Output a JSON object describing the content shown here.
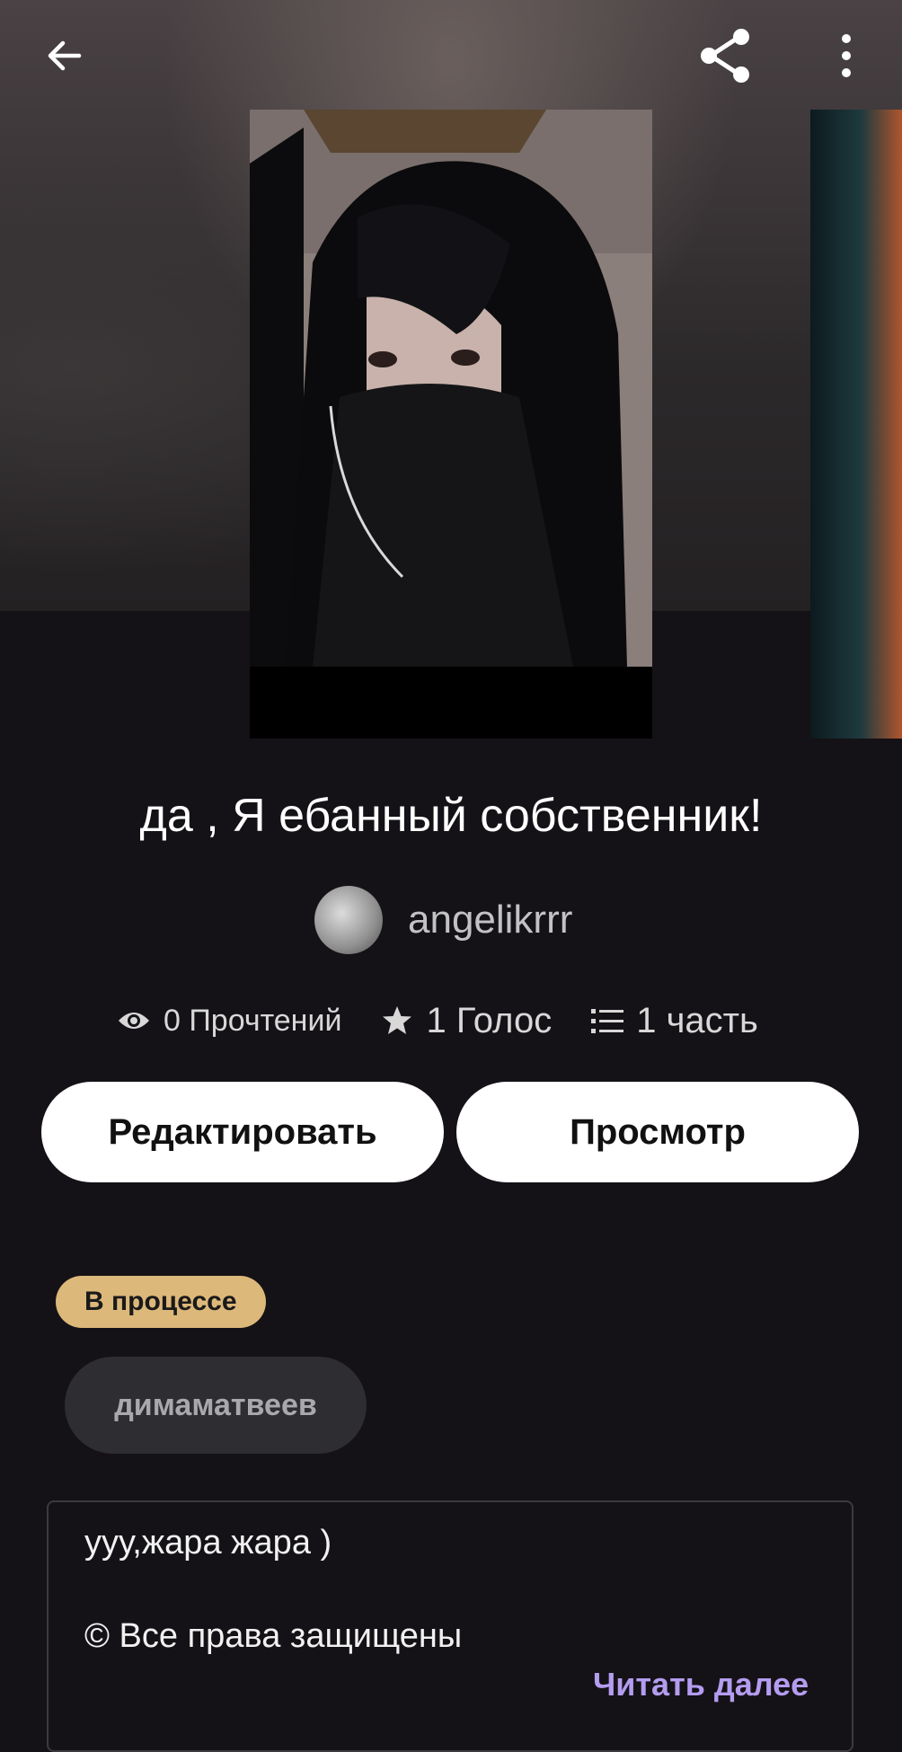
{
  "story": {
    "title": "да , Я ебанный собственник!",
    "author": "angelikrrr",
    "stats": {
      "reads": "0 Прочтений",
      "votes": "1 Голос",
      "parts": "1 часть"
    },
    "status": "В процессе",
    "tags": [
      "димаматвеев"
    ],
    "description": {
      "line1": "ууу,жара жара )",
      "line2": "© Все права защищены",
      "read_more": "Читать далее"
    }
  },
  "actions": {
    "edit_label": "Редактировать",
    "view_label": "Просмотр"
  },
  "icons": {
    "back": "arrow-left-icon",
    "share": "share-icon",
    "more": "more-vertical-icon",
    "reads": "eye-icon",
    "votes": "star-icon",
    "parts": "list-icon"
  },
  "colors": {
    "background": "#141216",
    "status_badge": "#dcb87a",
    "tag_chip": "#2e2d31",
    "read_more": "#b49cf0"
  }
}
